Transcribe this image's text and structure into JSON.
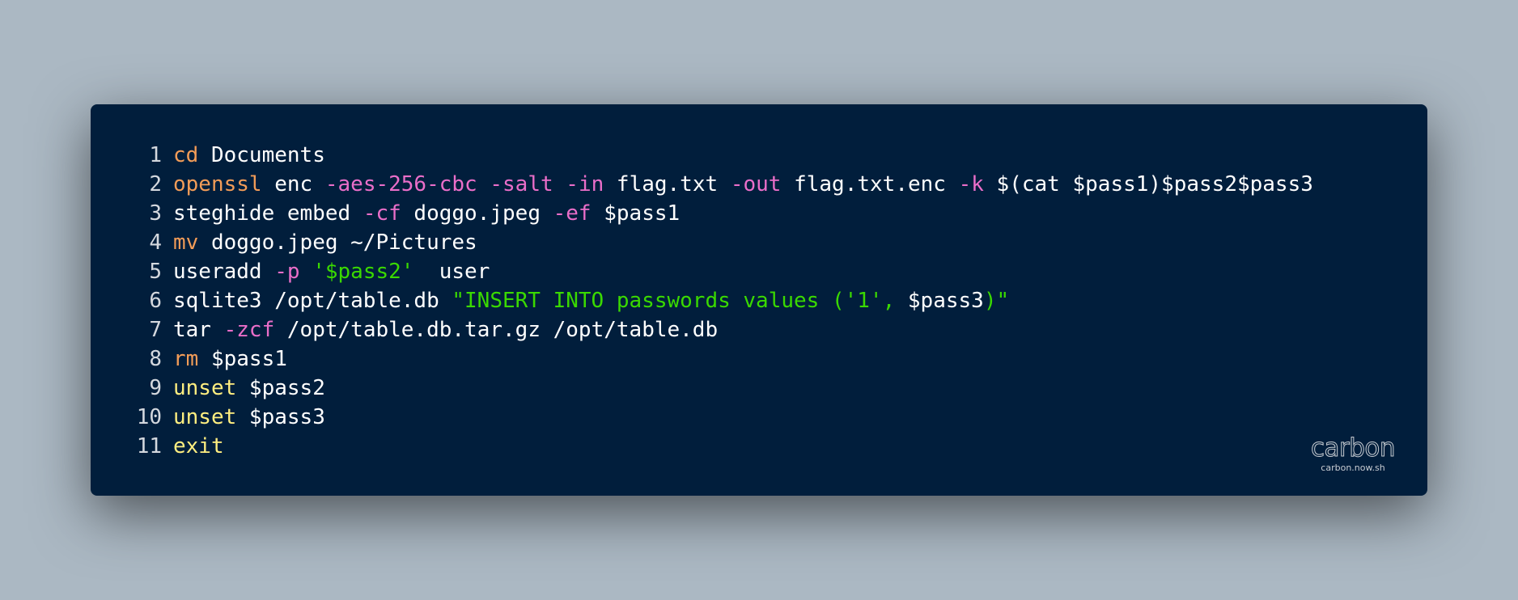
{
  "colors": {
    "background": "#abb8c3",
    "window": "#011e3c",
    "command": "#f29c58",
    "flag": "#ea6ec9",
    "string": "#3ad900",
    "keyword": "#ffee80",
    "plain": "#ffffff",
    "line_number": "#d4d8de"
  },
  "code": {
    "lines": [
      {
        "n": "1",
        "tokens": [
          [
            "cmd",
            "cd"
          ],
          [
            "plain",
            " Documents"
          ]
        ]
      },
      {
        "n": "2",
        "tokens": [
          [
            "cmd",
            "openssl"
          ],
          [
            "plain",
            " enc "
          ],
          [
            "flag",
            "-aes-256-cbc"
          ],
          [
            "plain",
            " "
          ],
          [
            "flag",
            "-salt"
          ],
          [
            "plain",
            " "
          ],
          [
            "flag",
            "-in"
          ],
          [
            "plain",
            " flag.txt "
          ],
          [
            "flag",
            "-out"
          ],
          [
            "plain",
            " flag.txt.enc "
          ],
          [
            "flag",
            "-k"
          ],
          [
            "plain",
            " $(cat $pass1)$pass2$pass3"
          ]
        ]
      },
      {
        "n": "3",
        "tokens": [
          [
            "plain",
            "steghide embed "
          ],
          [
            "flag",
            "-cf"
          ],
          [
            "plain",
            " doggo.jpeg "
          ],
          [
            "flag",
            "-ef"
          ],
          [
            "plain",
            " $pass1"
          ]
        ]
      },
      {
        "n": "4",
        "tokens": [
          [
            "cmd",
            "mv"
          ],
          [
            "plain",
            " doggo.jpeg ~/Pictures"
          ]
        ]
      },
      {
        "n": "5",
        "tokens": [
          [
            "plain",
            "useradd "
          ],
          [
            "flag",
            "-p"
          ],
          [
            "plain",
            " "
          ],
          [
            "str",
            "'$pass2'"
          ],
          [
            "plain",
            "  user"
          ]
        ]
      },
      {
        "n": "6",
        "tokens": [
          [
            "plain",
            "sqlite3 /opt/table.db "
          ],
          [
            "str",
            "\"INSERT INTO passwords values ('1', "
          ],
          [
            "plain",
            "$pass3"
          ],
          [
            "str",
            ")\""
          ]
        ]
      },
      {
        "n": "7",
        "tokens": [
          [
            "plain",
            "tar "
          ],
          [
            "flag",
            "-zcf"
          ],
          [
            "plain",
            " /opt/table.db.tar.gz /opt/table.db"
          ]
        ]
      },
      {
        "n": "8",
        "tokens": [
          [
            "cmd",
            "rm"
          ],
          [
            "plain",
            " $pass1"
          ]
        ]
      },
      {
        "n": "9",
        "tokens": [
          [
            "kw",
            "unset"
          ],
          [
            "plain",
            " $pass2"
          ]
        ]
      },
      {
        "n": "10",
        "tokens": [
          [
            "kw",
            "unset"
          ],
          [
            "plain",
            " $pass3"
          ]
        ]
      },
      {
        "n": "11",
        "tokens": [
          [
            "kw",
            "exit"
          ]
        ]
      }
    ]
  },
  "watermark": {
    "logo": "carbon",
    "url": "carbon.now.sh"
  }
}
